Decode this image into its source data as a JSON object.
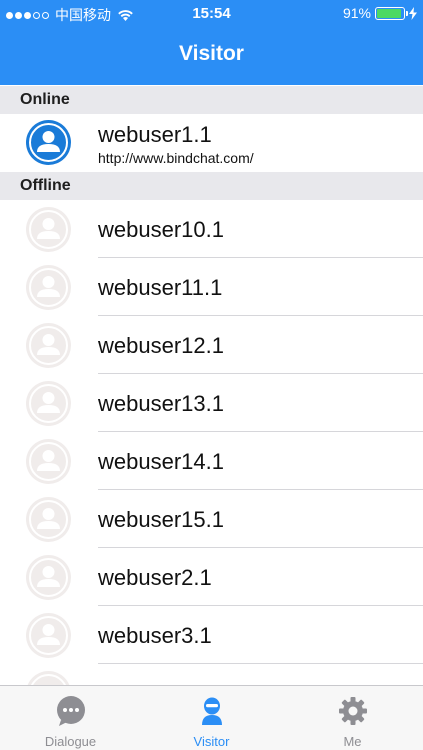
{
  "status_bar": {
    "carrier": "中国移动",
    "time": "15:54",
    "battery": "91%",
    "battery_level": 0.91
  },
  "nav": {
    "title": "Visitor"
  },
  "sections": {
    "online": {
      "header": "Online",
      "items": [
        {
          "name": "webuser1.1",
          "url": "http://www.bindchat.com/"
        }
      ]
    },
    "offline": {
      "header": "Offline",
      "items": [
        {
          "name": "webuser10.1"
        },
        {
          "name": "webuser11.1"
        },
        {
          "name": "webuser12.1"
        },
        {
          "name": "webuser13.1"
        },
        {
          "name": "webuser14.1"
        },
        {
          "name": "webuser15.1"
        },
        {
          "name": "webuser2.1"
        },
        {
          "name": "webuser3.1"
        }
      ]
    }
  },
  "tabbar": {
    "tabs": [
      {
        "label": "Dialogue",
        "icon": "chat-bubble-icon",
        "active": false
      },
      {
        "label": "Visitor",
        "icon": "visitor-icon",
        "active": true
      },
      {
        "label": "Me",
        "icon": "gear-icon",
        "active": false
      }
    ]
  },
  "colors": {
    "accent": "#2b8ef5",
    "online_avatar": "#1a7bd8",
    "offline_avatar": "#f0eceb",
    "section_bg": "#e8e8ec"
  }
}
